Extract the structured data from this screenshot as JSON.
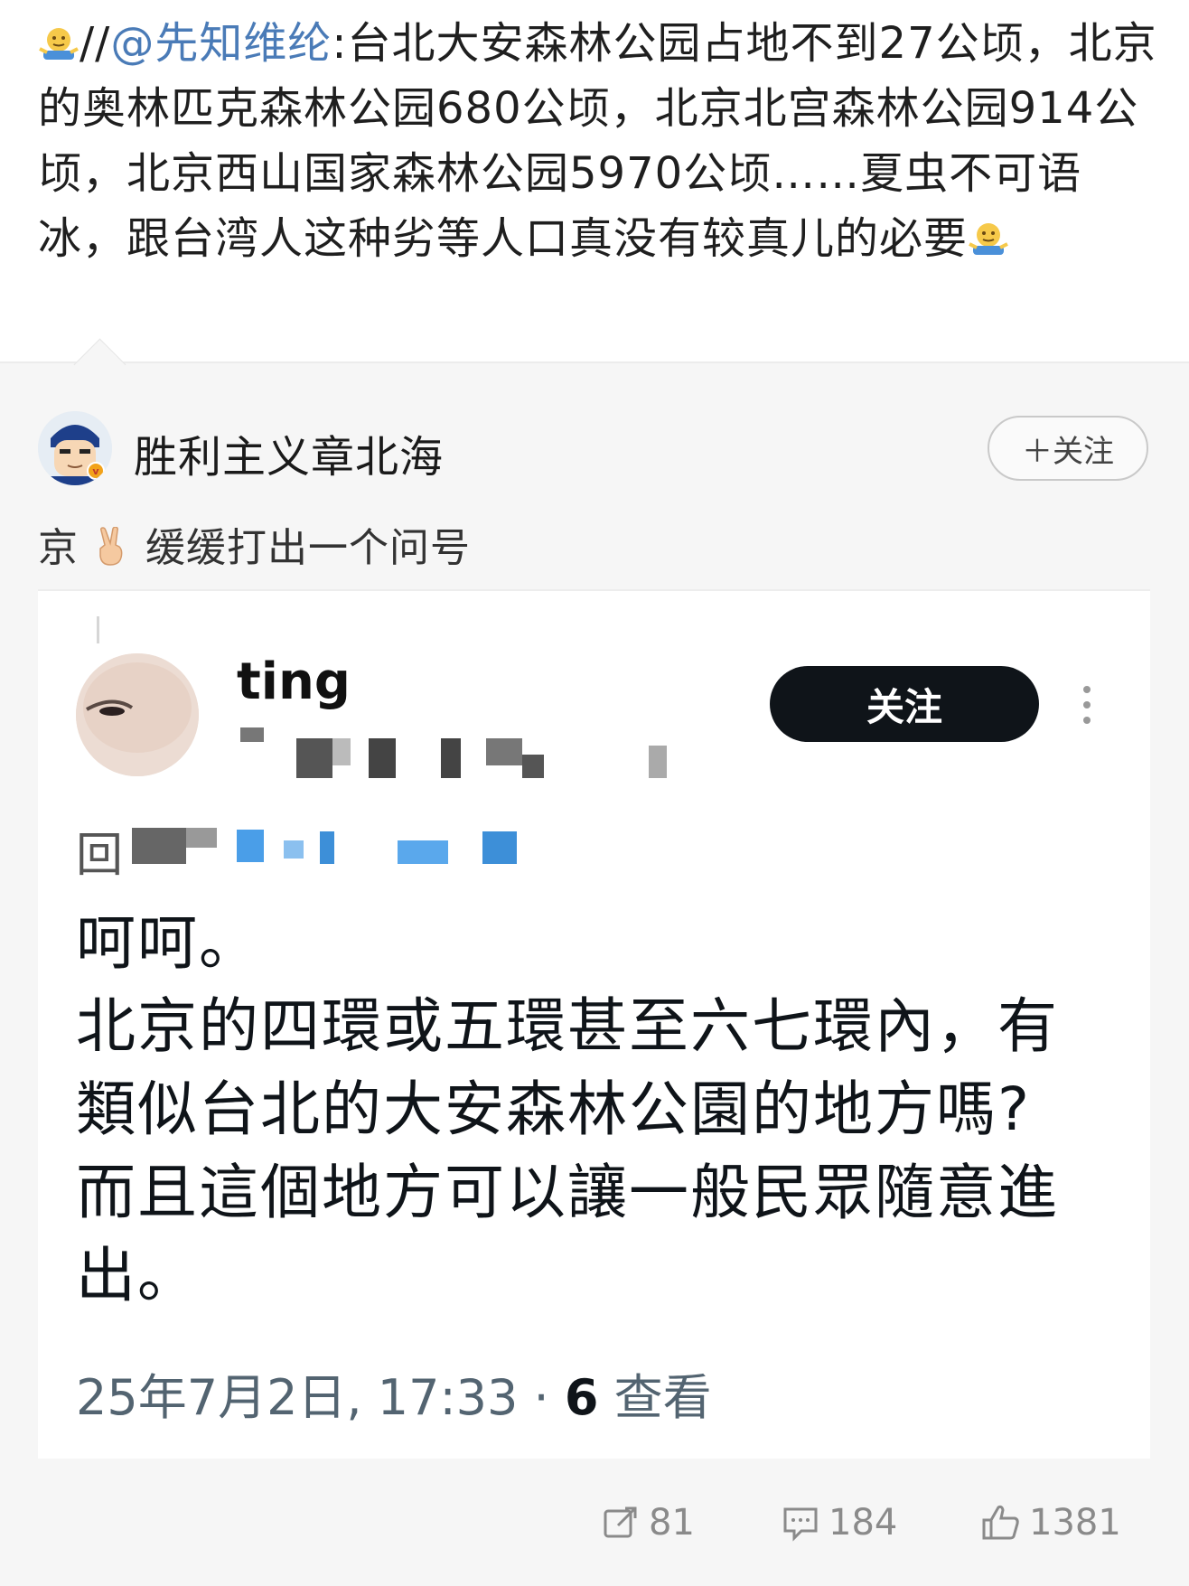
{
  "top_post": {
    "prefix": "//",
    "mention": "@先知维纶",
    "text": ":台北大安森林公园占地不到27公顷，北京的奥林匹克森林公园680公顷，北京北宫森林公园914公顷，北京西山国家森林公园5970公顷……夏虫不可语冰，跟台湾人这种劣等人口真没有较真儿的必要",
    "emoji": "shrug-emoji"
  },
  "repost": {
    "username": "胜利主义章北海",
    "follow_label": "＋关注",
    "location": "京",
    "text": "缓缓打出一个问号"
  },
  "embedded": {
    "name": "ting",
    "follow_label": "关注",
    "reply_prefix": "回",
    "body_lines": [
      "呵呵。",
      "北京的四環或五環甚至六七環內，有",
      "類似台北的大安森林公園的地方嗎?",
      "而且這個地方可以讓一般民眾隨意進",
      "出。"
    ],
    "meta_time": "25年7月2日, 17:33 · ",
    "meta_views_num": "6",
    "meta_views_label": " 查看"
  },
  "actions": {
    "share_count": "81",
    "comment_count": "184",
    "like_count": "1381"
  },
  "colors": {
    "mention": "#4a7bb7",
    "follow_dark": "#0f1419",
    "meta_gray": "#536471"
  }
}
